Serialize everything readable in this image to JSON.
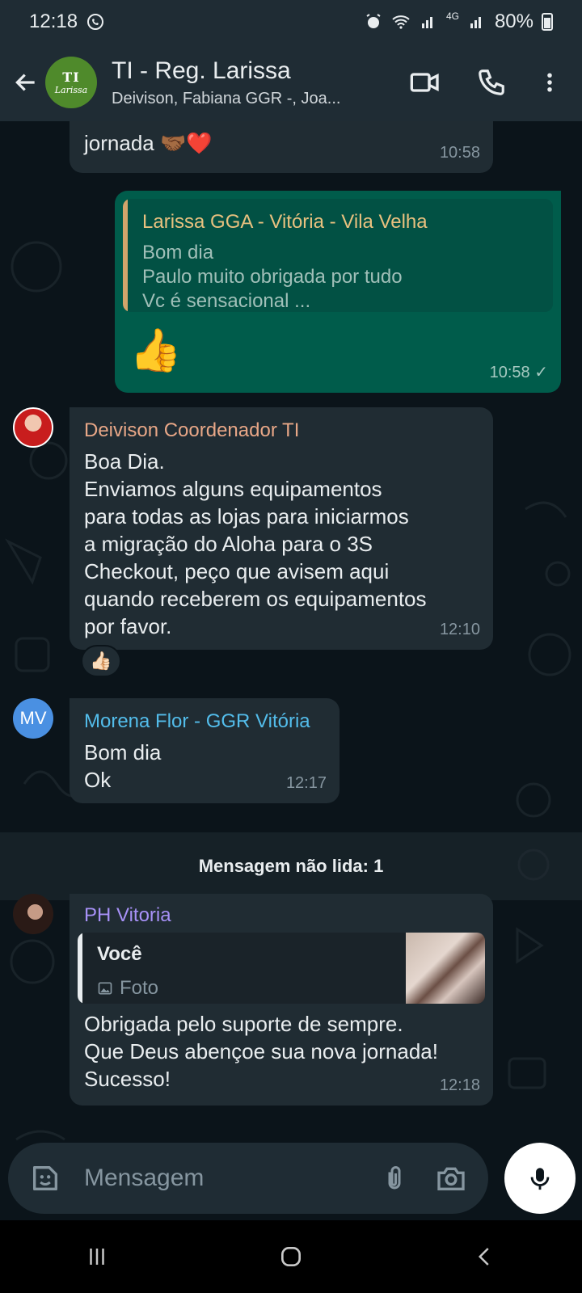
{
  "status_bar": {
    "time": "12:18",
    "battery": "80%",
    "network": "4G"
  },
  "header": {
    "title": "TI - Reg. Larissa",
    "subtitle": "Deivison, Fabiana GGR -, Joa...",
    "avatar_logo_top": "TI",
    "avatar_logo_bottom": "Larissa"
  },
  "messages": [
    {
      "id": "m1",
      "direction": "in",
      "text": "jornada 🤝🏾❤️",
      "time": "10:58"
    },
    {
      "id": "m2",
      "direction": "out",
      "quote": {
        "name": "Larissa GGA - Vitória - Vila Velha",
        "lines": [
          "Bom dia",
          "Paulo muito obrigada por tudo",
          "Vc é sensacional ..."
        ]
      },
      "text": "👍",
      "time": "10:58",
      "status": "✓"
    },
    {
      "id": "m3",
      "direction": "in",
      "sender": "Deivison Coordenador TI",
      "sender_color": "#e8a787",
      "lines": [
        "Boa Dia.",
        "Enviamos alguns equipamentos",
        "para todas as lojas para iniciarmos",
        "a migração do Aloha para o 3S",
        "Checkout, peço que avisem aqui",
        "quando receberem os equipamentos",
        "por favor."
      ],
      "time": "12:10",
      "reaction": "👍🏻"
    },
    {
      "id": "m4",
      "direction": "in",
      "sender": "Morena Flor - GGR Vitória",
      "sender_color": "#53bdeb",
      "avatar_initials": "MV",
      "lines": [
        "Bom dia",
        "Ok"
      ],
      "time": "12:17"
    },
    {
      "id": "m5",
      "direction": "in",
      "sender": "PH Vitoria",
      "sender_color": "#a791f7",
      "quote": {
        "name": "Você",
        "media_label": "Foto"
      },
      "lines": [
        "Obrigada pelo suporte de sempre.",
        "Que Deus abençoe sua nova jornada!",
        "Sucesso!"
      ],
      "time": "12:18"
    }
  ],
  "unread_banner": "Mensagem não lida: 1",
  "input": {
    "placeholder": "Mensagem"
  },
  "colors": {
    "chat_bg": "#0b141a",
    "bubble_in": "#202c33",
    "bubble_out": "#005c4b",
    "header_bg": "#1f2c34"
  }
}
